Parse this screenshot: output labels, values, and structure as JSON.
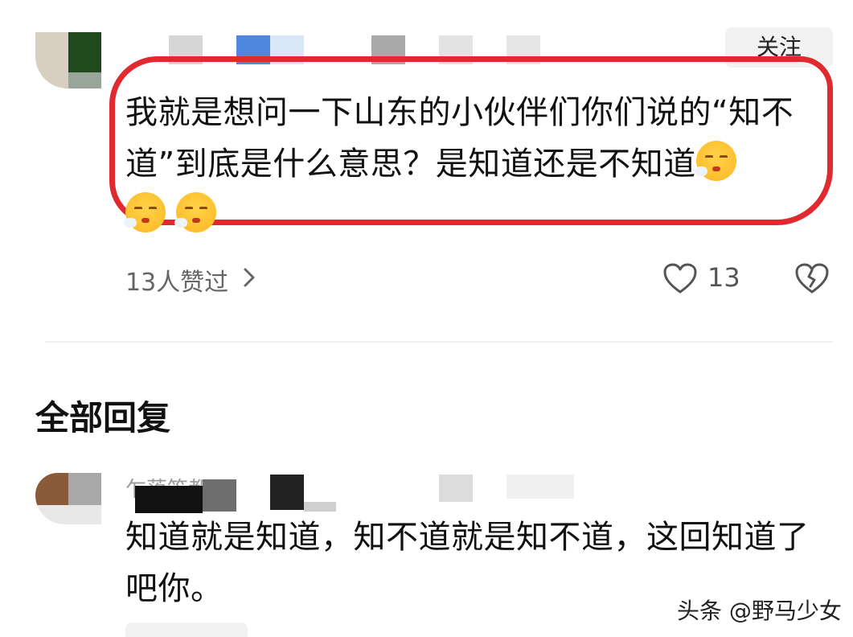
{
  "post": {
    "follow_label": "关注",
    "text": "我就是想问一下山东的小伙伴们你们说的“知不道”到底是什么意思？是知道还是不知道",
    "emoji_name": "sleepy-face-emoji",
    "likes_summary": "13人赞过",
    "like_count": "13"
  },
  "replies_section": {
    "title": "全部回复"
  },
  "reply": {
    "name": "乍落笛都不",
    "text": "知道就是知道，知不道就是知不道，这回知道了吧你。"
  },
  "watermark": "头条 @野马少女",
  "colors": {
    "highlight": "#e02a2f",
    "emoji": "#ffc43a",
    "muted_text": "#666666"
  }
}
